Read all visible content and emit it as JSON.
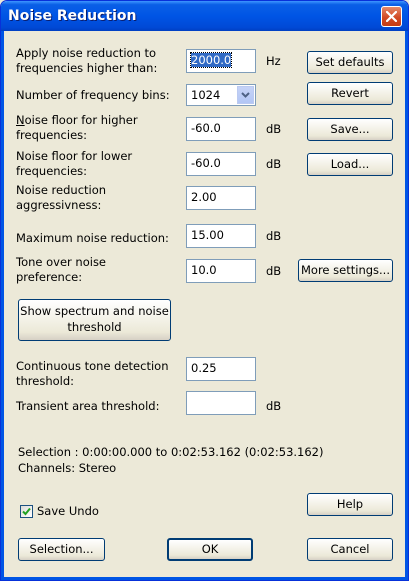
{
  "window": {
    "title": "Noise Reduction"
  },
  "fields": {
    "freq_label_l1": "Apply noise reduction to",
    "freq_label_l2": "frequencies higher than:",
    "freq_value": "2000.0",
    "freq_unit": "Hz",
    "bins_label": "Number of frequency bins:",
    "bins_value": "1024",
    "nf_high_label_l1": "Noise floor for higher",
    "nf_high_label_l2": "frequencies:",
    "nf_high_value": "-60.0",
    "nf_high_unit": "dB",
    "nf_low_label_l1": "Noise floor for lower",
    "nf_low_label_l2": "frequencies:",
    "nf_low_value": "-60.0",
    "nf_low_unit": "dB",
    "aggr_label_l1": "Noise reduction",
    "aggr_label_l2": "aggressivness:",
    "aggr_value": "2.00",
    "max_label": "Maximum noise reduction:",
    "max_value": "15.00",
    "max_unit": "dB",
    "tone_label_l1": "Tone over noise",
    "tone_label_l2": "preference:",
    "tone_value": "10.0",
    "tone_unit": "dB",
    "cont_label_l1": "Continuous tone detection",
    "cont_label_l2": "threshold:",
    "cont_value": "0.25",
    "trans_label": "Transient area threshold:",
    "trans_value": "",
    "trans_unit": "dB"
  },
  "buttons": {
    "set_defaults": "Set defaults",
    "revert": "Revert",
    "save": "Save...",
    "load": "Load...",
    "more_settings": "More settings...",
    "show_spectrum_l1": "Show spectrum and noise",
    "show_spectrum_l2": "threshold",
    "help": "Help",
    "selection": "Selection...",
    "ok": "OK",
    "cancel": "Cancel"
  },
  "info": {
    "selection": "Selection : 0:00:00.000 to 0:02:53.162 (0:02:53.162)",
    "channels": "Channels: Stereo"
  },
  "save_undo": {
    "label": "Save Undo",
    "checked": true
  }
}
